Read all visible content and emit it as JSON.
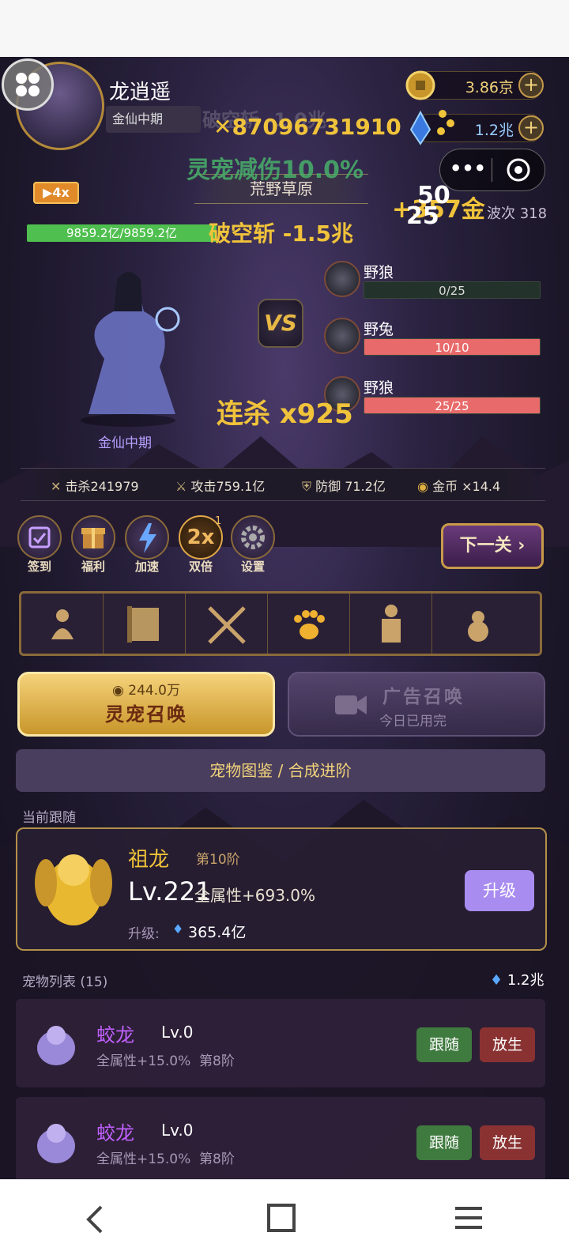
{
  "player": {
    "name": "龙逍遥",
    "realm": "金仙中期",
    "hp": "9859.2亿/9859.2亿",
    "hp_fraction": 1.0,
    "speed_badge": "▶4x"
  },
  "currency": {
    "gold": "3.86京",
    "gem": "1.2兆"
  },
  "stage": {
    "name": "荒野草原",
    "wave_label": "波次 318"
  },
  "floating": {
    "damage_total": "87096731910",
    "buff_text": "灵宠减伤10.0%",
    "skill_hit": "破空斩 -1.5兆",
    "gold_gain": "+357金",
    "num_a": "50",
    "num_b": "25",
    "combo": "连杀 x925",
    "ghost_top": "破空斩 -1.0兆"
  },
  "enemies": [
    {
      "name": "野狼",
      "hp": "0/25",
      "fraction": 0.0
    },
    {
      "name": "野兔",
      "hp": "10/10",
      "fraction": 1.0
    },
    {
      "name": "野狼",
      "hp": "25/25",
      "fraction": 1.0
    }
  ],
  "vs_label": "VS",
  "stats": [
    {
      "label": "击杀241979"
    },
    {
      "label": "攻击759.1亿"
    },
    {
      "label": "防御 71.2亿"
    },
    {
      "label": "金币 ×14.4"
    }
  ],
  "actions": [
    {
      "label": "签到"
    },
    {
      "label": "福利"
    },
    {
      "label": "加速"
    },
    {
      "label": "双倍",
      "glyph": "2x",
      "badge": "1"
    },
    {
      "label": "设置"
    }
  ],
  "next_level": "下一关",
  "summon": {
    "cost": "244.0万",
    "label": "灵宠召唤",
    "ad_label": "广告召唤",
    "ad_status": "今日已用完"
  },
  "codex_button": "宠物图鉴 / 合成进阶",
  "current_follow": {
    "section_label": "当前跟随",
    "name": "祖龙",
    "tier": "第10阶",
    "level": "Lv.221",
    "bonus": "全属性+693.0%",
    "upgrade_label": "升级:",
    "upgrade_cost": "365.4亿",
    "upgrade_button": "升级"
  },
  "pet_list": {
    "title": "宠物列表 (15)",
    "balance": "1.2兆",
    "items": [
      {
        "name": "蛟龙",
        "level": "Lv.0",
        "bonus": "全属性+15.0%",
        "tier": "第8阶",
        "follow": "跟随",
        "release": "放生"
      },
      {
        "name": "蛟龙",
        "level": "Lv.0",
        "bonus": "全属性+15.0%",
        "tier": "第8阶",
        "follow": "跟随",
        "release": "放生"
      }
    ]
  },
  "colors": {
    "accent_gold": "#f0c33a",
    "hp_green": "#4fbf4f",
    "enemy_red": "#e86a6a",
    "purple_btn": "#a98cf0"
  }
}
